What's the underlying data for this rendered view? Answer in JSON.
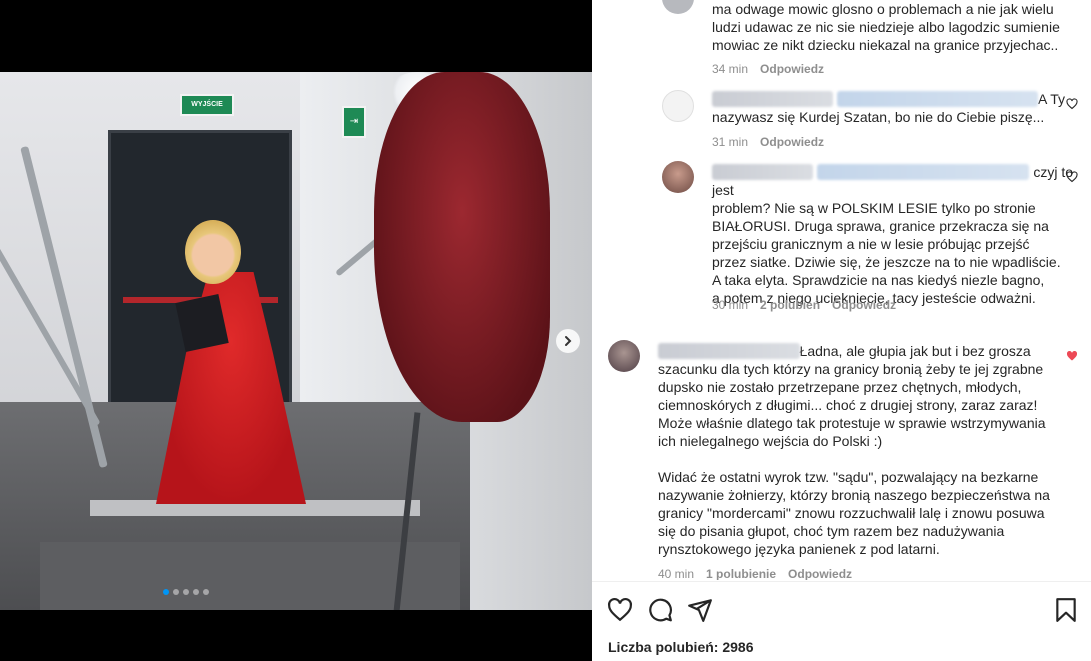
{
  "media": {
    "exit_sign_text": "WYJŚCIE",
    "carousel_dots": 5,
    "active_dot": 0
  },
  "comments": [
    {
      "id": "c1",
      "username": "",
      "mention": "",
      "lines": [
        "ma odwage mowic glosno o problemach a nie jak wielu",
        "ludzi udawac ze nic sie niedzieje albo lagodzic sumienie",
        "mowiac ze nikt dziecku niekazal na granice przyjechac.."
      ],
      "time": "34 min",
      "likes": "",
      "reply": "Odpowiedz"
    },
    {
      "id": "c2",
      "username": "",
      "mention": "",
      "first_line_suffix": "A Ty",
      "lines": [
        "nazywasz się Kurdej Szatan, bo nie do Ciebie piszę..."
      ],
      "time": "31 min",
      "likes": "",
      "reply": "Odpowiedz"
    },
    {
      "id": "c3",
      "username": "",
      "mention": "",
      "first_line_suffix": "czyj to jest",
      "lines": [
        "problem? Nie są w POLSKIM LESIE tylko po stronie",
        "BIAŁORUSI. Druga sprawa, granice przekracza się na",
        "przejściu granicznym a nie w lesie próbując przejść",
        "przez siatke. Dziwie się, że jeszcze na to nie wpadliście.",
        "A taka elyta. Sprawdzicie na nas kiedyś niezle bagno,",
        "a potem z niego uciekniecie, tacy jesteście odważni."
      ],
      "time": "30 min",
      "likes": "2 polubień",
      "reply": "Odpowiedz"
    },
    {
      "id": "c4",
      "username": "",
      "first_line_suffix": "Ładna, ale głupia jak but i bez grosza",
      "lines": [
        "szacunku dla tych którzy na granicy bronią żeby te jej zgrabne",
        "dupsko nie zostało przetrzepane przez chętnych, młodych,",
        "ciemnoskórych z długimi... choć z drugiej strony, zaraz zaraz!",
        "Może właśnie dlatego tak protestuje w sprawie wstrzymywania",
        "ich nielegalnego wejścia do Polski :)",
        "",
        "Widać że ostatni wyrok tzw. \"sądu\", pozwalający na bezkarne",
        "nazywanie żołnierzy, którzy bronią naszego bezpieczeństwa na",
        "granicy \"mordercami\" znowu rozzuchwalił lalę i znowu posuwa",
        "się do pisania głupot, choć tym razem bez nadużywania",
        "rynsztokowego języka panienek z pod latarni."
      ],
      "time": "40 min",
      "likes": "1 polubienie",
      "reply": "Odpowiedz"
    }
  ],
  "actions": {
    "likes_label": "Liczba polubień:",
    "likes_value": "2986"
  },
  "colors": {
    "liked_heart": "#ed4956",
    "text": "#262626",
    "meta": "#8e8e8e"
  }
}
